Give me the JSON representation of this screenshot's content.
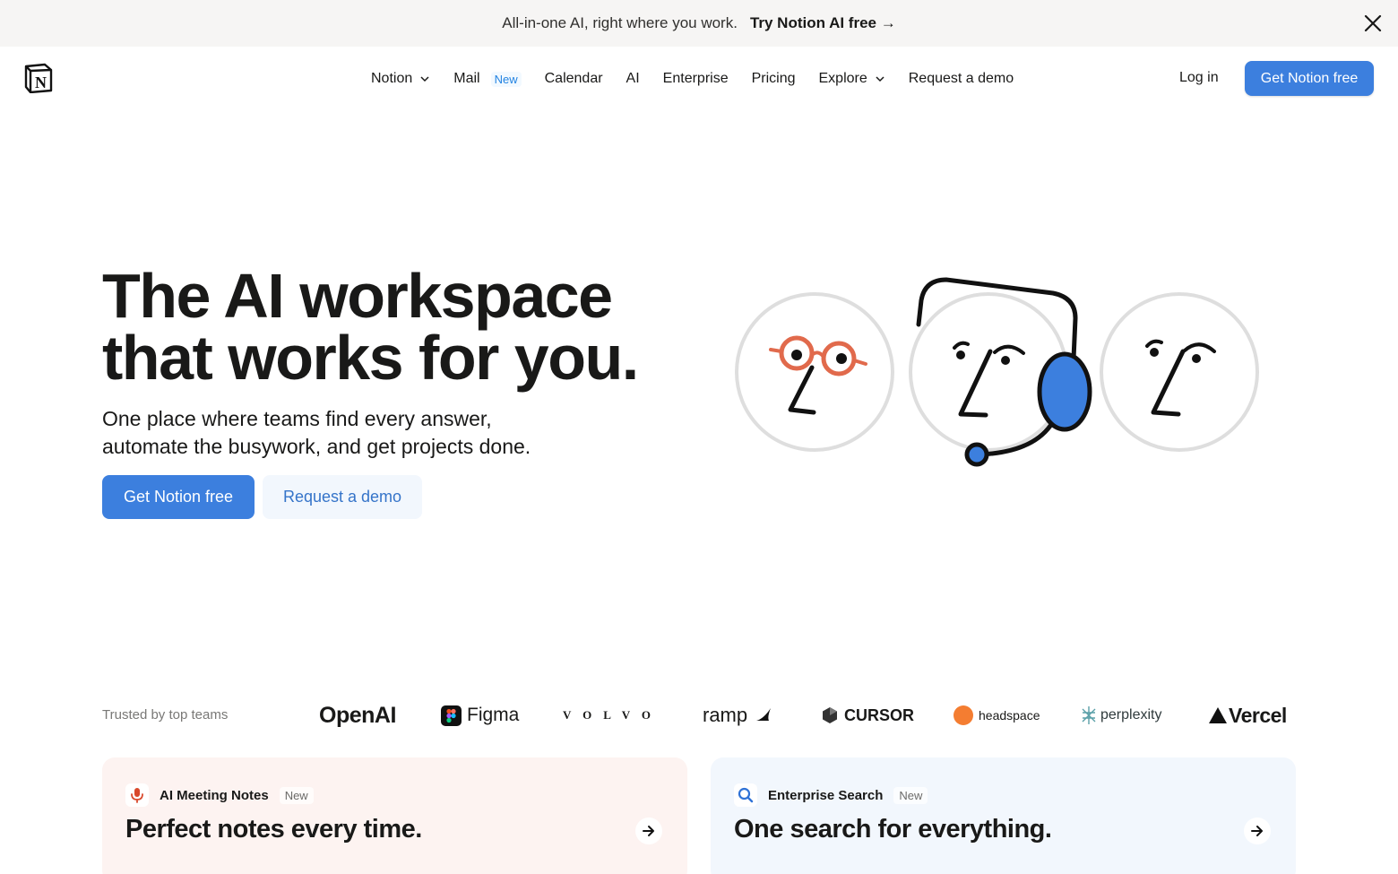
{
  "announcement": {
    "message": "All-in-one AI, right where you work.",
    "cta": "Try Notion AI free →"
  },
  "nav": {
    "items": [
      {
        "label": "Notion",
        "has_dropdown": true
      },
      {
        "label": "Mail",
        "badge": "New"
      },
      {
        "label": "Calendar"
      },
      {
        "label": "AI"
      },
      {
        "label": "Enterprise"
      },
      {
        "label": "Pricing"
      },
      {
        "label": "Explore",
        "has_dropdown": true
      },
      {
        "label": "Request a demo"
      }
    ],
    "login": "Log in",
    "cta": "Get Notion free"
  },
  "hero": {
    "title_line1": "The AI workspace",
    "title_line2": "that works for you.",
    "subtitle_line1": "One place where teams find every answer,",
    "subtitle_line2": "automate the busywork, and get projects done.",
    "primary_cta": "Get Notion free",
    "secondary_cta": "Request a demo"
  },
  "trusted": {
    "label": "Trusted by top teams",
    "logos": [
      "OpenAI",
      "Figma",
      "VOLVO",
      "ramp",
      "CURSOR",
      "headspace",
      "perplexity",
      "Vercel"
    ]
  },
  "cards": [
    {
      "label": "AI Meeting Notes",
      "badge": "New",
      "title": "Perfect notes every time.",
      "icon": "microphone-icon"
    },
    {
      "label": "Enterprise Search",
      "badge": "New",
      "title": "One search for everything.",
      "icon": "search-icon"
    }
  ],
  "colors": {
    "brand_blue": "#3c7fde",
    "announce_bg": "#f6f5f4",
    "card_left_bg": "#fdf3f1",
    "card_right_bg": "#f2f7fd",
    "accent_orange": "#e16a4c"
  }
}
